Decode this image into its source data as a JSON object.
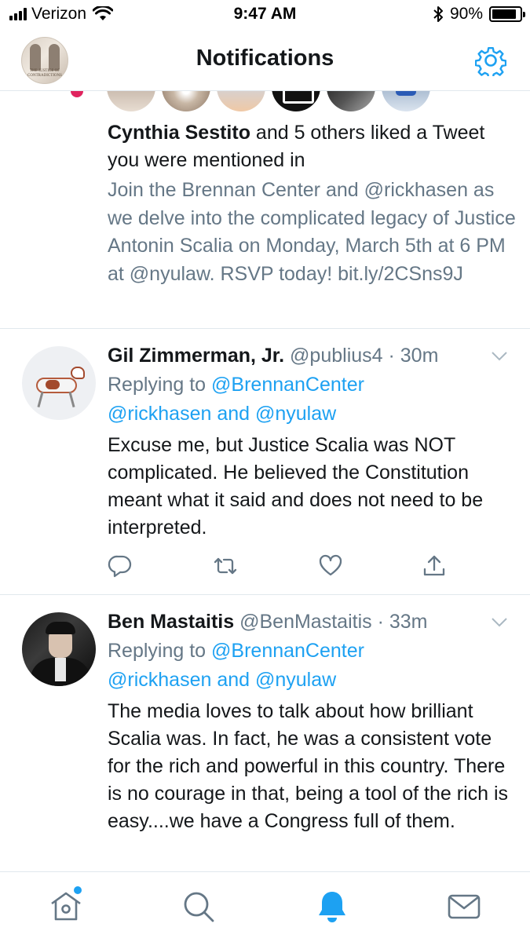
{
  "status_bar": {
    "carrier": "Verizon",
    "time": "9:47 AM",
    "battery": "90%"
  },
  "header": {
    "title": "Notifications",
    "avatar_caption": "THE JUSTICE OF CONTRADICTIONS"
  },
  "notification": {
    "actor": "Cynthia Sestito",
    "action": " and 5 others liked a Tweet you were mentioned in",
    "quote": "Join the Brennan Center and @rickhasen as we delve into the complicated legacy of Justice Antonin Scalia on Monday, March 5th at 6 PM at @nyulaw. RSVP today! bit.ly/2CSns9J"
  },
  "tweets": [
    {
      "name": "Gil Zimmerman, Jr.",
      "handle": "@publius4",
      "time": "30m",
      "replying_prefix": "Replying to ",
      "replying_to": "@BrennanCenter",
      "replying_more": "@rickhasen and @nyulaw",
      "text": "Excuse me, but Justice Scalia was NOT complicated. He believed the Constitution meant what it said and does not need to be interpreted."
    },
    {
      "name": "Ben Mastaitis",
      "handle": "@BenMastaitis",
      "time": "33m",
      "replying_prefix": "Replying to ",
      "replying_to": "@BrennanCenter",
      "replying_more": "@rickhasen and @nyulaw",
      "text": "The media loves to talk about how brilliant Scalia was. In fact, he was a consistent vote for the rich and powerful in this country. There is no courage in that, being a tool of the rich is easy....we have a Congress full of them."
    }
  ],
  "icons": {
    "settings": "gear-icon",
    "reply": "reply-icon",
    "retweet": "retweet-icon",
    "like": "heart-icon",
    "share": "share-icon",
    "home": "home-icon",
    "search": "search-icon",
    "notifications": "bell-icon",
    "messages": "mail-icon"
  },
  "colors": {
    "accent": "#1da1f2",
    "text": "#14171a",
    "secondary": "#657786",
    "divider": "#e1e8ed"
  }
}
